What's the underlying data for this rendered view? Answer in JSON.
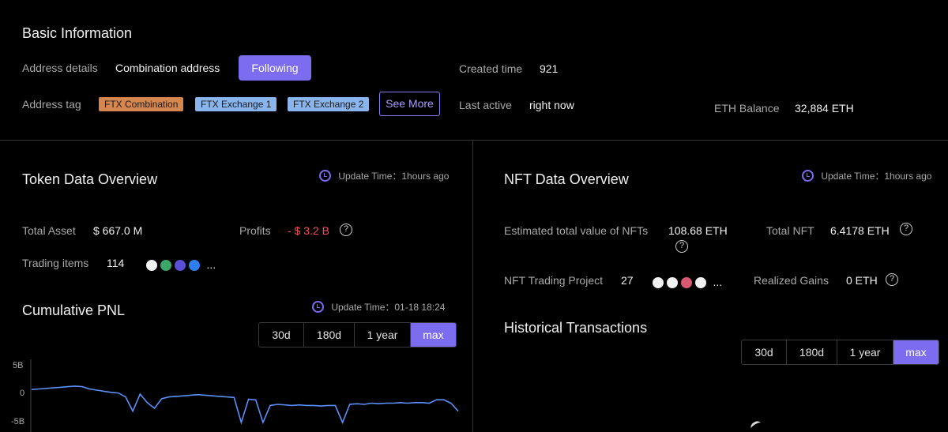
{
  "basic": {
    "title": "Basic Information",
    "address_details_label": "Address details",
    "address_details_value": "Combination address",
    "follow_button": "Following",
    "created_label": "Created time",
    "created_value": "921",
    "address_tag_label": "Address tag",
    "tags": [
      "FTX Combination",
      "FTX Exchange 1",
      "FTX Exchange 2"
    ],
    "see_more": "See More",
    "last_active_label": "Last active",
    "last_active_value": "right now",
    "eth_balance_label": "ETH Balance",
    "eth_balance_value": "32,884 ETH"
  },
  "token": {
    "title": "Token Data Overview",
    "update_time": "Update Time：1hours ago",
    "total_asset_label": "Total Asset",
    "total_asset_value": "$ 667.0 M",
    "profits_label": "Profits",
    "profits_value": "- $ 3.2 B",
    "trading_items_label": "Trading items",
    "trading_items_value": "114",
    "more": "..."
  },
  "pnl": {
    "title": "Cumulative PNL",
    "update_time": "Update Time：01-18 18:24",
    "ranges": [
      "30d",
      "180d",
      "1 year",
      "max"
    ],
    "active_range": "max"
  },
  "nft": {
    "title": "NFT Data Overview",
    "update_time": "Update Time：1hours ago",
    "est_label": "Estimated total value of NFTs",
    "est_value": "108.68 ETH",
    "total_label": "Total NFT",
    "total_value": "6.4178 ETH",
    "project_label": "NFT Trading Project",
    "project_value": "27",
    "realized_label": "Realized Gains",
    "realized_value": "0 ETH",
    "more": "..."
  },
  "historical": {
    "title": "Historical Transactions",
    "ranges": [
      "30d",
      "180d",
      "1 year",
      "max"
    ],
    "active_range": "max"
  },
  "chart_data": {
    "type": "line",
    "ylim": [
      -5,
      5
    ],
    "y_ticks": [
      "5B",
      "0",
      "-5B"
    ],
    "color": "#5b8ff9",
    "series": [
      {
        "values": [
          0.8,
          0.9,
          1.0,
          1.1,
          1.2,
          1.3,
          1.4,
          1.3,
          0.9,
          0.7,
          0.5,
          0.3,
          0.2,
          -0.5,
          -3.0,
          0.0,
          -1.5,
          -2.5,
          -0.8,
          -0.5,
          -0.4,
          -0.3,
          -0.2,
          -0.1,
          -0.2,
          -0.3,
          -0.4,
          -0.5,
          -0.6,
          -5.0,
          -0.9,
          -1.0,
          -5.0,
          -2.0,
          -1.8,
          -1.9,
          -2.0,
          -1.9,
          -2.0,
          -2.0,
          -2.1,
          -2.0,
          -2.0,
          -5.0,
          -1.8,
          -1.7,
          -1.8,
          -1.6,
          -1.7,
          -1.6,
          -1.6,
          -1.5,
          -1.6,
          -1.5,
          -1.5,
          -1.6,
          -1.0,
          -1.0,
          -1.6,
          -3.0
        ]
      }
    ]
  }
}
